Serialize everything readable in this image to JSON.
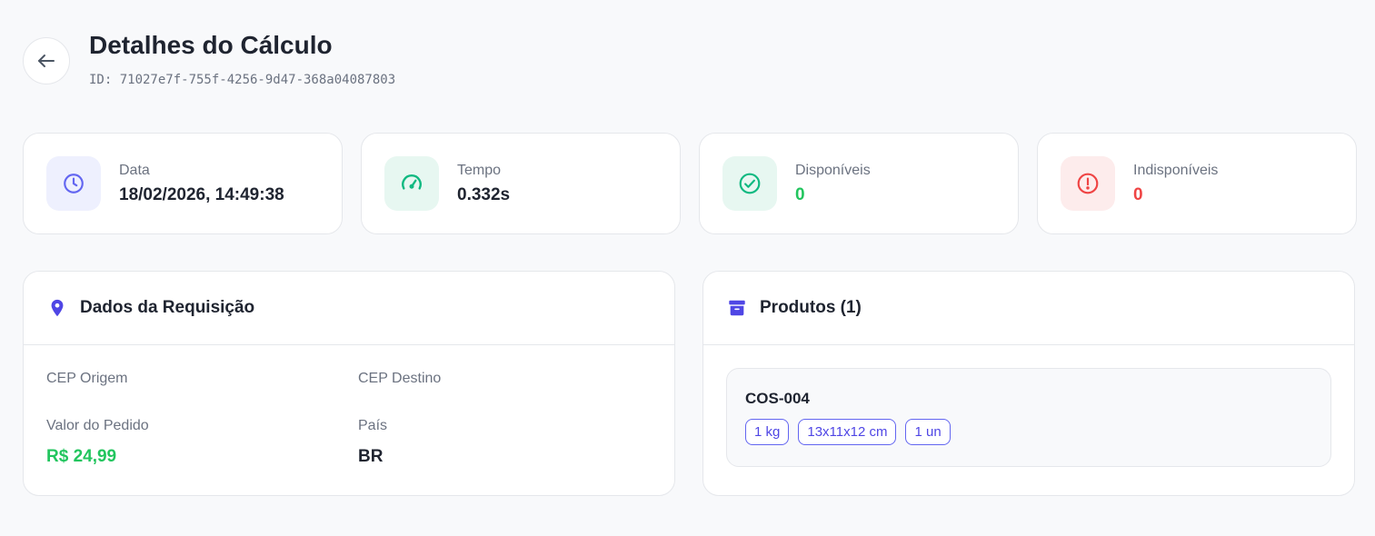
{
  "header": {
    "title": "Detalhes do Cálculo",
    "id_text": "ID: 71027e7f-755f-4256-9d47-368a04087803"
  },
  "stats": [
    {
      "label": "Data",
      "value": "18/02/2026, 14:49:38",
      "icon": "clock-icon",
      "color": "#1f2430",
      "icon_color": "#6366f1",
      "bg": "#eef0fe"
    },
    {
      "label": "Tempo",
      "value": "0.332s",
      "icon": "speedometer-icon",
      "color": "#1f2430",
      "icon_color": "#10b981",
      "bg": "#e7f7f1"
    },
    {
      "label": "Disponíveis",
      "value": "0",
      "icon": "check-circle-icon",
      "color": "#22c55e",
      "icon_color": "#10b981",
      "bg": "#e7f7f1"
    },
    {
      "label": "Indisponíveis",
      "value": "0",
      "icon": "alert-circle-icon",
      "color": "#ef4444",
      "icon_color": "#ef4444",
      "bg": "#fdecec"
    }
  ],
  "request": {
    "title": "Dados da Requisição",
    "icon": "map-pin-icon",
    "cep_origem_label": "CEP Origem",
    "cep_destino_label": "CEP Destino",
    "valor_label": "Valor do Pedido",
    "valor_value": "R$ 24,99",
    "pais_label": "País",
    "pais_value": "BR"
  },
  "products": {
    "title": "Produtos (1)",
    "icon": "archive-box-icon",
    "items": [
      {
        "sku": "COS-004",
        "tags": [
          "1 kg",
          "13x11x12 cm",
          "1 un"
        ]
      }
    ]
  },
  "colors": {
    "accent": "#6366f1",
    "success": "#22c55e",
    "danger": "#ef4444"
  }
}
